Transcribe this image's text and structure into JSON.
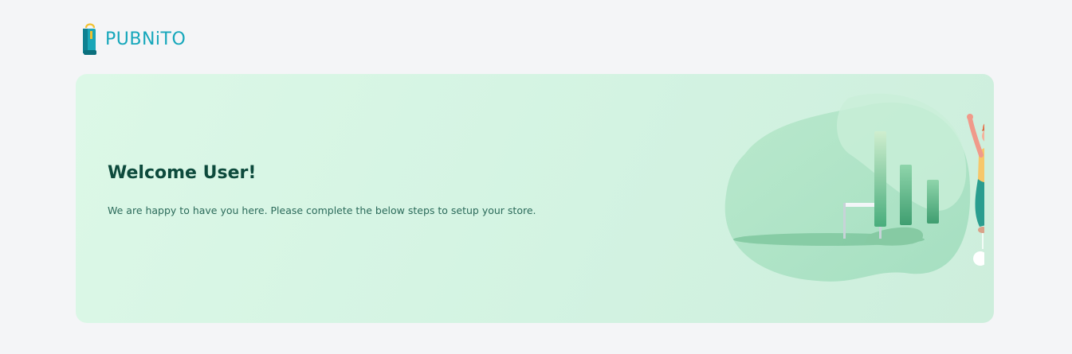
{
  "brand": {
    "name": "PUBNiTO",
    "logo_icon": "shopping-bag-icon",
    "color": "#16a7bb"
  },
  "welcome": {
    "title": "Welcome User!",
    "subtitle": "We are happy to have you here. Please complete the below steps to setup your store.",
    "illustration": "woman-jumping-with-bar-chart-illustration",
    "card_color": "#d8f6e5",
    "title_color": "#0d4a3c"
  }
}
